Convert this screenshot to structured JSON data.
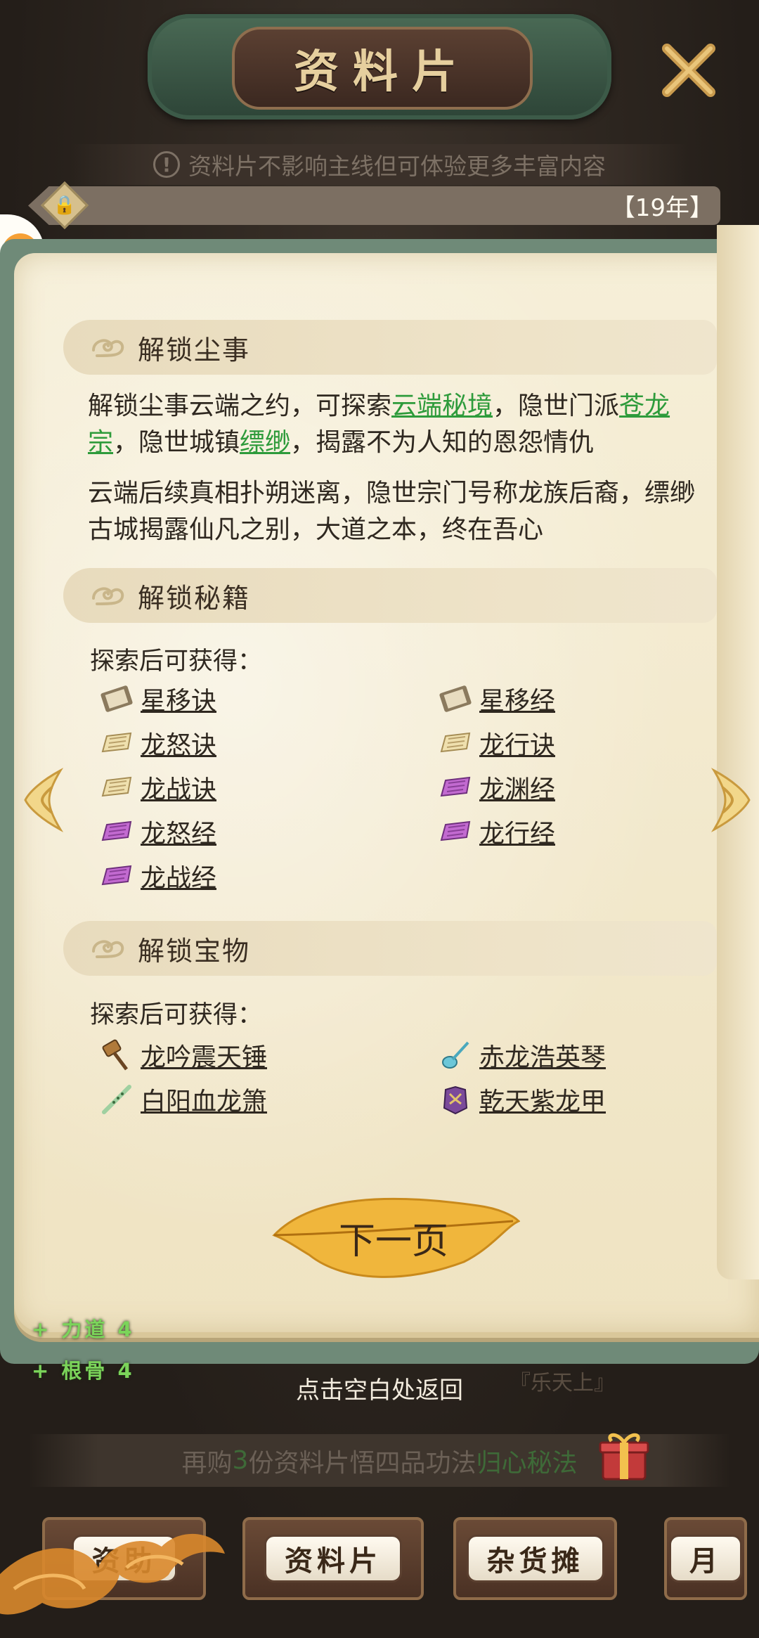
{
  "header": {
    "title": "资料片"
  },
  "notice": {
    "icon": "!",
    "text": "资料片不影响主线但可体验更多丰富内容"
  },
  "year_label": "【19年】",
  "sections": {
    "dust": {
      "title": "解锁尘事",
      "p1": {
        "a": "解锁尘事云端之约，可探索",
        "link1": "云端秘境",
        "b": "，隐世门派",
        "link2": "苍龙宗",
        "c": "，隐世城镇",
        "link3": "缥缈",
        "d": "，揭露不为人知的恩怨情仇"
      },
      "p2": "云端后续真相扑朔迷离，隐世宗门号称龙族后裔，缥缈古城揭露仙凡之别，大道之本，终在吾心"
    },
    "manuals": {
      "title": "解锁秘籍",
      "sub": "探索后可获得：",
      "items": [
        {
          "name": "星移诀",
          "icon": "scroll-book-icon"
        },
        {
          "name": "星移经",
          "icon": "scroll-book-icon"
        },
        {
          "name": "龙怒诀",
          "icon": "yellow-book-icon"
        },
        {
          "name": "龙行诀",
          "icon": "yellow-book-icon"
        },
        {
          "name": "龙战诀",
          "icon": "yellow-book-icon"
        },
        {
          "name": "龙渊经",
          "icon": "purple-book-icon"
        },
        {
          "name": "龙怒经",
          "icon": "purple-book-icon"
        },
        {
          "name": "龙行经",
          "icon": "purple-book-icon"
        },
        {
          "name": "龙战经",
          "icon": "purple-book-icon"
        }
      ]
    },
    "treasures": {
      "title": "解锁宝物",
      "sub": "探索后可获得：",
      "items": [
        {
          "name": "龙吟震天锤",
          "icon": "hammer-icon"
        },
        {
          "name": "赤龙浩英琴",
          "icon": "lute-icon"
        },
        {
          "name": "白阳血龙箫",
          "icon": "flute-icon"
        },
        {
          "name": "乾天紫龙甲",
          "icon": "armor-icon"
        }
      ]
    }
  },
  "next_page": "下一页",
  "stats": [
    "+ 力道 4",
    "+ 根骨 4"
  ],
  "tap_return": "点击空白处返回",
  "book_title_tag": "『乐天上』",
  "promo": {
    "a": "再购",
    "num": "3",
    "b": "份资料片悟四品功法",
    "highlight": "归心秘法"
  },
  "bottom_tabs": [
    "资助",
    "资料片",
    "杂货摊",
    "月"
  ],
  "colors": {
    "link_green": "#2e9b3b",
    "stat_green": "#7bd45a",
    "parchment": "#f6efd8"
  }
}
